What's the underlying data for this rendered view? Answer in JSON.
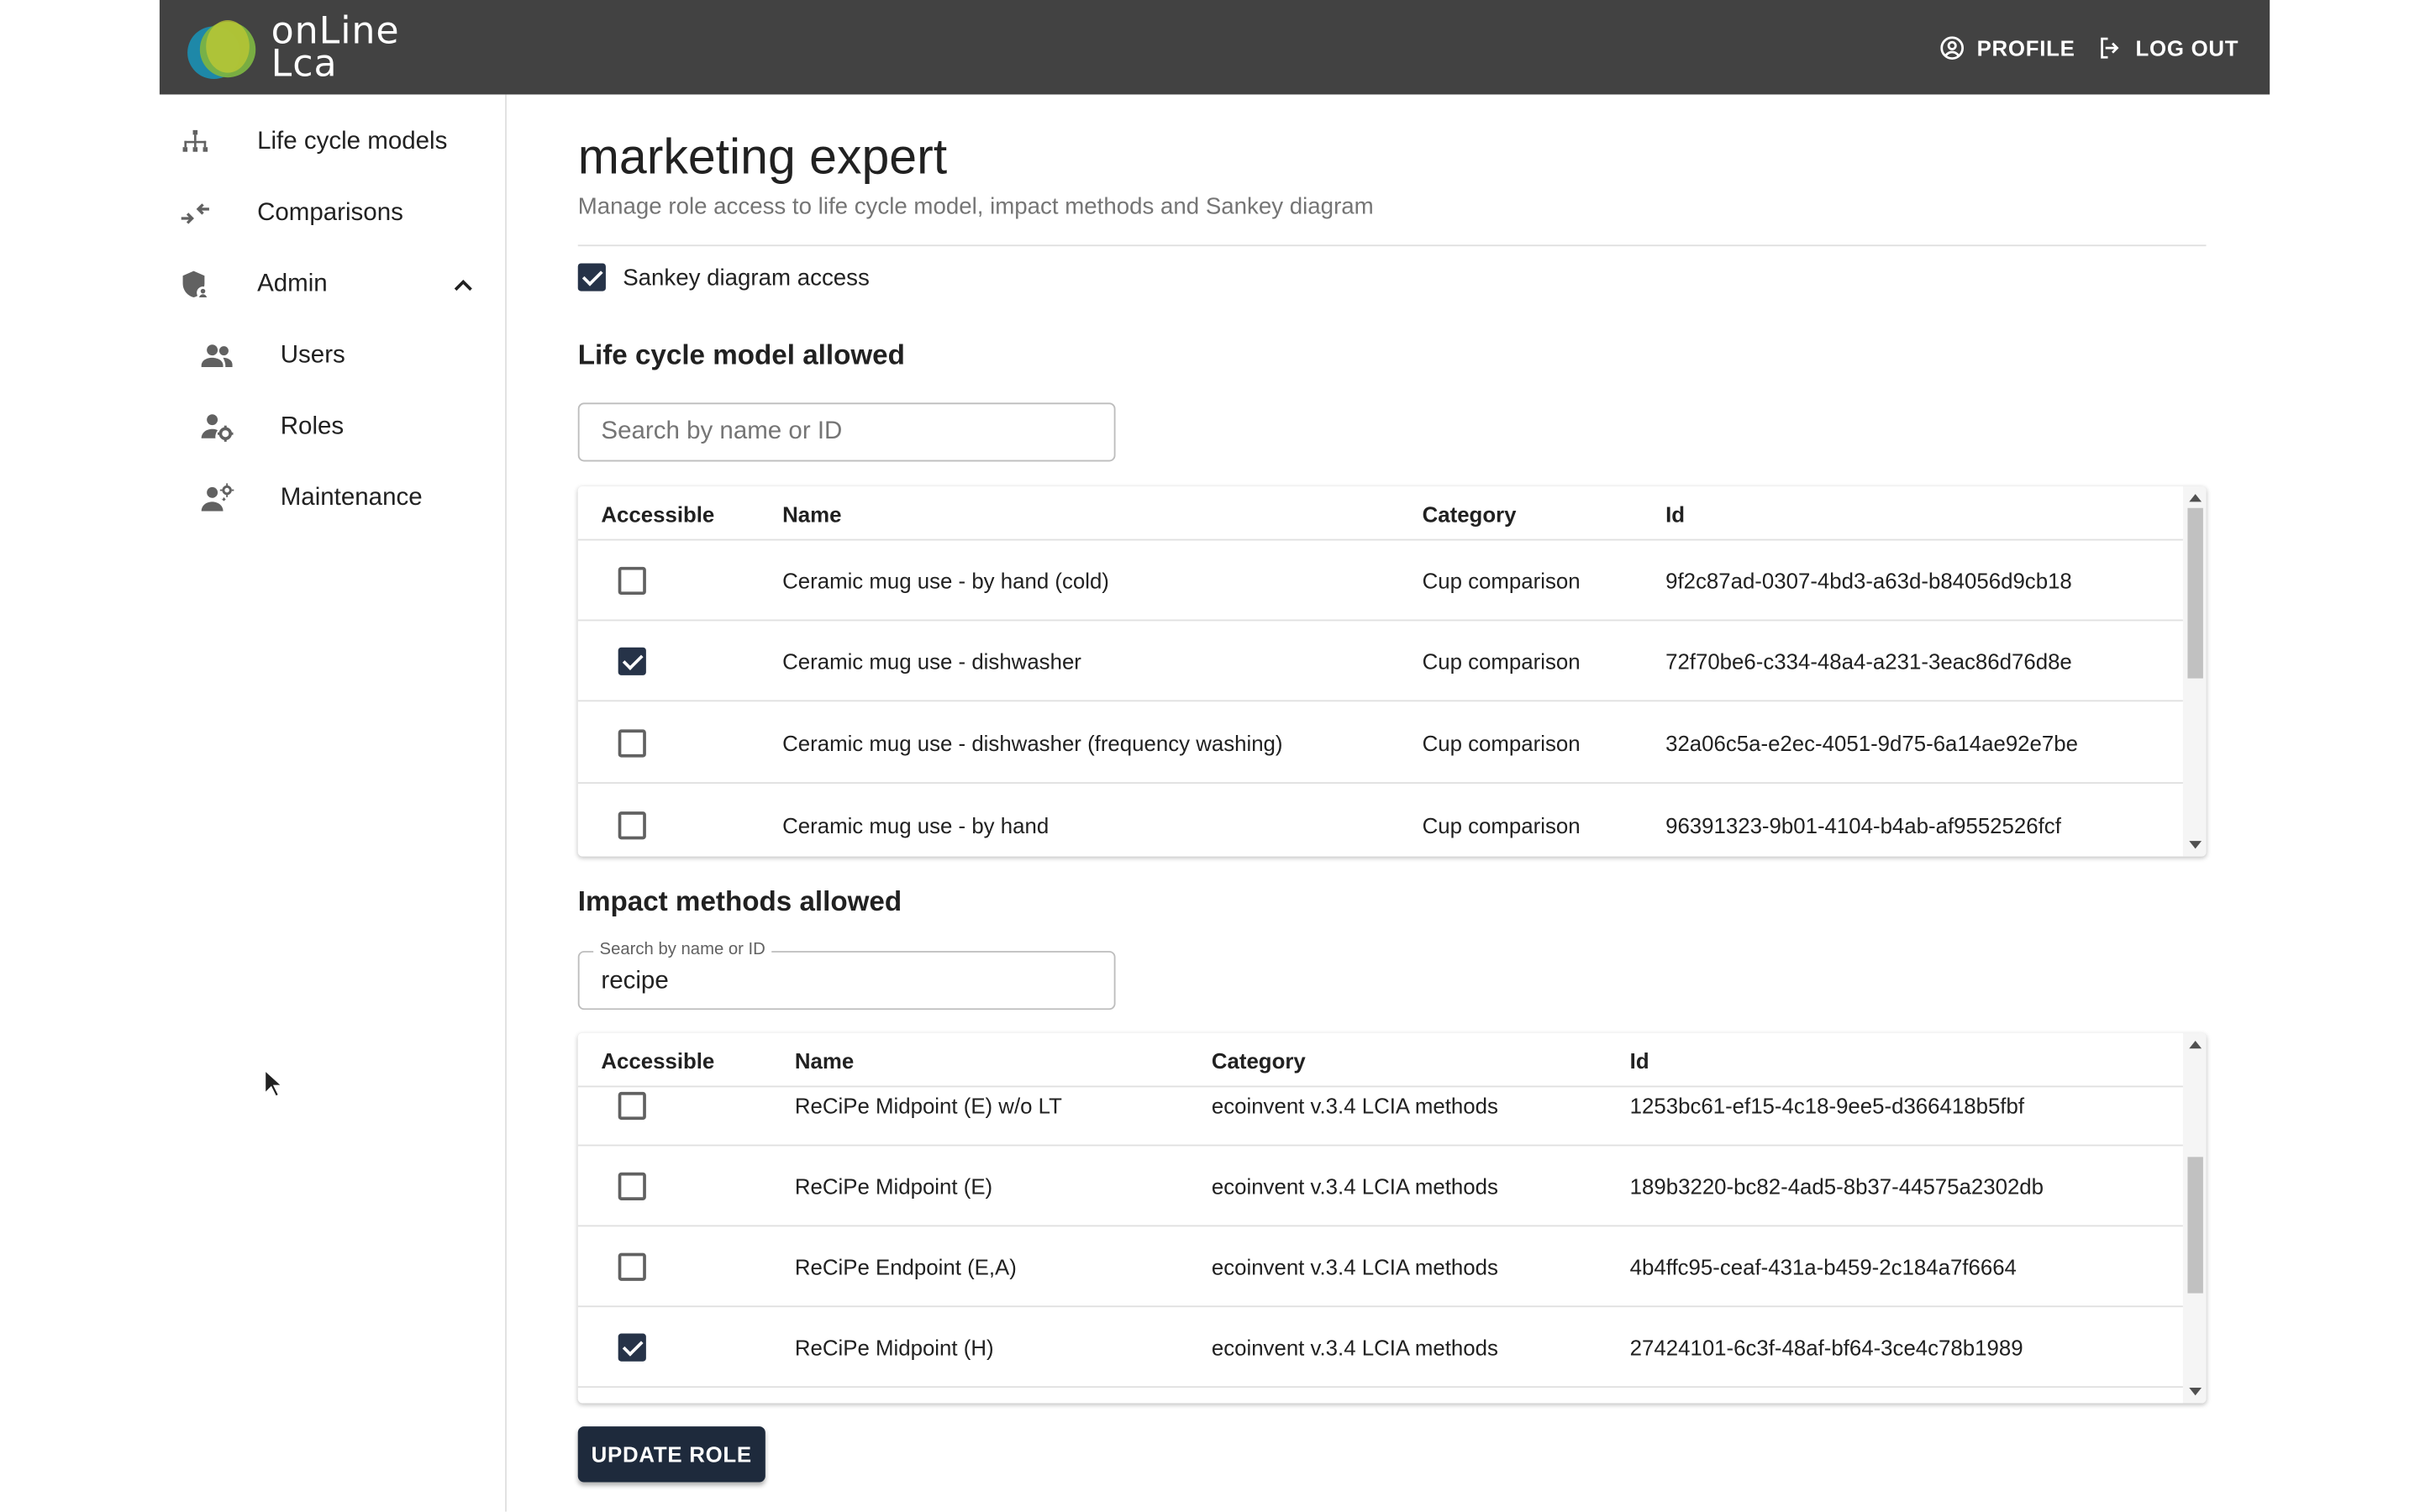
{
  "header": {
    "logo_line1": "onLine",
    "logo_line2": "Lca",
    "profile_label": "PROFILE",
    "logout_label": "LOG OUT"
  },
  "sidebar": {
    "items": [
      {
        "label": "Life cycle models",
        "icon": "sitemap-icon"
      },
      {
        "label": "Comparisons",
        "icon": "compare-arrows-icon"
      },
      {
        "label": "Admin",
        "icon": "admin-shield-icon",
        "expanded": true
      },
      {
        "label": "Users",
        "icon": "users-icon"
      },
      {
        "label": "Roles",
        "icon": "role-settings-icon"
      },
      {
        "label": "Maintenance",
        "icon": "maintenance-icon"
      }
    ]
  },
  "page": {
    "title": "marketing expert",
    "subtitle": "Manage role access to life cycle model, impact methods and Sankey diagram",
    "sankey_label": "Sankey diagram access",
    "sankey_checked": true
  },
  "lcm": {
    "title": "Life cycle model allowed",
    "search_placeholder": "Search by name or ID",
    "columns": [
      "Accessible",
      "Name",
      "Category",
      "Id"
    ],
    "rows": [
      {
        "checked": false,
        "name": "Ceramic mug use - by hand (cold)",
        "category": "Cup comparison",
        "id": "9f2c87ad-0307-4bd3-a63d-b84056d9cb18"
      },
      {
        "checked": true,
        "name": "Ceramic mug use - dishwasher",
        "category": "Cup comparison",
        "id": "72f70be6-c334-48a4-a231-3eac86d76d8e"
      },
      {
        "checked": false,
        "name": "Ceramic mug use - dishwasher (frequency washing)",
        "category": "Cup comparison",
        "id": "32a06c5a-e2ec-4051-9d75-6a14ae92e7be"
      },
      {
        "checked": false,
        "name": "Ceramic mug use - by hand",
        "category": "Cup comparison",
        "id": "96391323-9b01-4104-b4ab-af9552526fcf"
      }
    ]
  },
  "impact": {
    "title": "Impact methods allowed",
    "search_label": "Search by name or ID",
    "search_value": "recipe",
    "columns": [
      "Accessible",
      "Name",
      "Category",
      "Id"
    ],
    "rows": [
      {
        "checked": false,
        "name": "ReCiPe Midpoint (E) w/o LT",
        "category": "ecoinvent v.3.4 LCIA methods",
        "id": "1253bc61-ef15-4c18-9ee5-d366418b5fbf"
      },
      {
        "checked": false,
        "name": "ReCiPe Midpoint (E)",
        "category": "ecoinvent v.3.4 LCIA methods",
        "id": "189b3220-bc82-4ad5-8b37-44575a2302db"
      },
      {
        "checked": false,
        "name": "ReCiPe Endpoint (E,A)",
        "category": "ecoinvent v.3.4 LCIA methods",
        "id": "4b4ffc95-ceaf-431a-b459-2c184a7f6664"
      },
      {
        "checked": true,
        "name": "ReCiPe Midpoint (H)",
        "category": "ecoinvent v.3.4 LCIA methods",
        "id": "27424101-6c3f-48af-bf64-3ce4c78b1989"
      }
    ]
  },
  "actions": {
    "update_label": "UPDATE ROLE"
  },
  "colors": {
    "topbar": "#424242",
    "accent": "#263348",
    "button": "#1e2a3c"
  }
}
